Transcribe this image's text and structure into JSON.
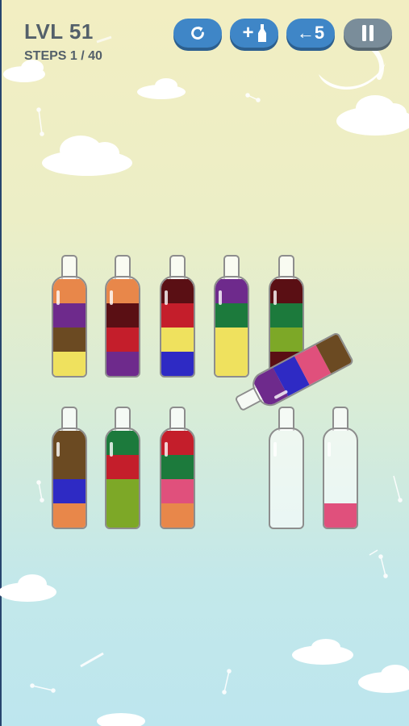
{
  "header": {
    "level": "LVL 51",
    "steps": "STEPS 1 / 40"
  },
  "buttons": {
    "restart_icon": "restart-icon",
    "add_bottle_label": "+",
    "add_bottle_icon": "bottle-icon",
    "undo_label": "←5",
    "pause_icon": "pause-icon"
  },
  "colors": {
    "orange": "#e8874a",
    "purple": "#6e2a8c",
    "brown": "#6b4a22",
    "yellow": "#efe15e",
    "maroon": "#5a0f14",
    "red": "#c41e2b",
    "blue": "#2e2ac4",
    "green": "#1c7a3c",
    "lime": "#7da827",
    "pink": "#e0507c"
  },
  "bottles_row1": [
    {
      "layers_bottom_to_top": [
        "yellow",
        "brown",
        "purple",
        "orange"
      ]
    },
    {
      "layers_bottom_to_top": [
        "purple",
        "red",
        "maroon",
        "orange"
      ]
    },
    {
      "layers_bottom_to_top": [
        "blue",
        "yellow",
        "red",
        "maroon"
      ]
    },
    {
      "layers_bottom_to_top": [
        "yellow",
        "yellow",
        "green",
        "purple"
      ]
    },
    {
      "layers_bottom_to_top": [
        "maroon",
        "lime",
        "green",
        "maroon"
      ]
    },
    {
      "layers_bottom_to_top": [
        "brown",
        "pink",
        "blue",
        "purple"
      ],
      "tilted": true
    }
  ],
  "bottles_row2": [
    {
      "layers_bottom_to_top": [
        "orange",
        "blue",
        "brown",
        "brown"
      ]
    },
    {
      "layers_bottom_to_top": [
        "lime",
        "lime",
        "red",
        "green"
      ]
    },
    {
      "layers_bottom_to_top": [
        "orange",
        "pink",
        "green",
        "red"
      ]
    },
    {
      "layers_bottom_to_top": []
    },
    {
      "layers_bottom_to_top": [
        "pink"
      ]
    }
  ]
}
